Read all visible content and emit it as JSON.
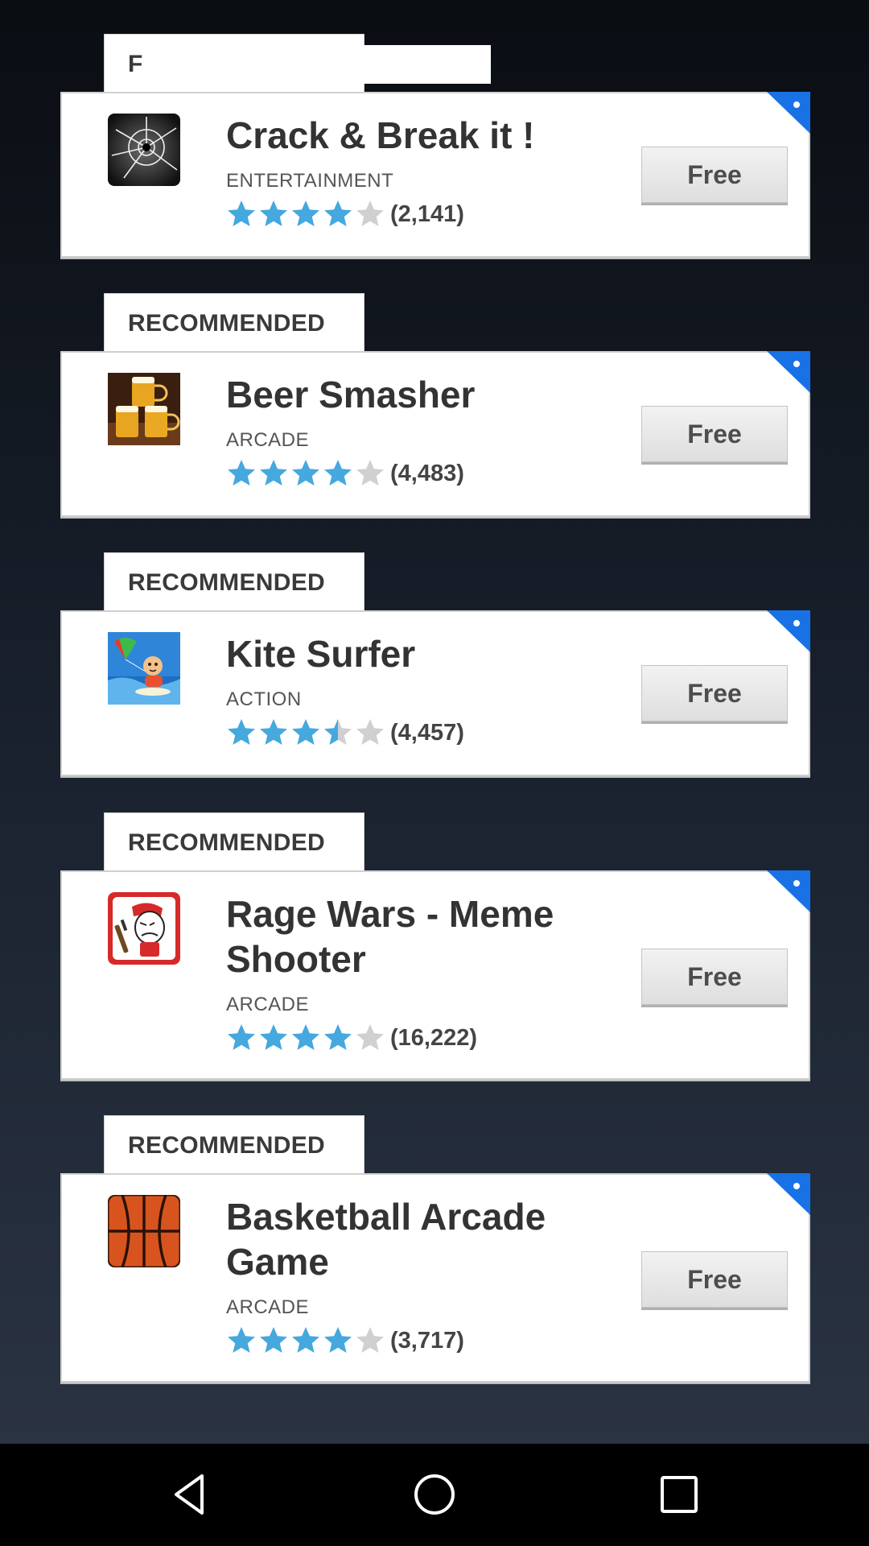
{
  "top_tab_label": "F",
  "apps": [
    {
      "tab_label": "",
      "title": "Crack & Break it !",
      "category": "ENTERTAINMENT",
      "rating": 4,
      "rating_count": "(2,141)",
      "price_label": "Free",
      "icon": "cracked-glass-icon"
    },
    {
      "tab_label": "RECOMMENDED",
      "title": "Beer Smasher",
      "category": "ARCADE",
      "rating": 4,
      "rating_count": "(4,483)",
      "price_label": "Free",
      "icon": "beer-mugs-icon"
    },
    {
      "tab_label": "RECOMMENDED",
      "title": "Kite Surfer",
      "category": "ACTION",
      "rating": 3.5,
      "rating_count": "(4,457)",
      "price_label": "Free",
      "icon": "kite-surfer-icon"
    },
    {
      "tab_label": "RECOMMENDED",
      "title": "Rage Wars - Meme Shooter",
      "category": "ARCADE",
      "rating": 4,
      "rating_count": "(16,222)",
      "price_label": "Free",
      "icon": "rage-meme-icon"
    },
    {
      "tab_label": "RECOMMENDED",
      "title": "Basketball Arcade Game",
      "category": "ARCADE",
      "rating": 4,
      "rating_count": "(3,717)",
      "price_label": "Free",
      "icon": "basketball-icon"
    }
  ],
  "colors": {
    "star_filled": "#45a8de",
    "star_empty": "#d0d0d0",
    "corner_badge": "#1872e6"
  },
  "navbar": {
    "back": "back-icon",
    "home": "home-icon",
    "recents": "recents-icon"
  }
}
